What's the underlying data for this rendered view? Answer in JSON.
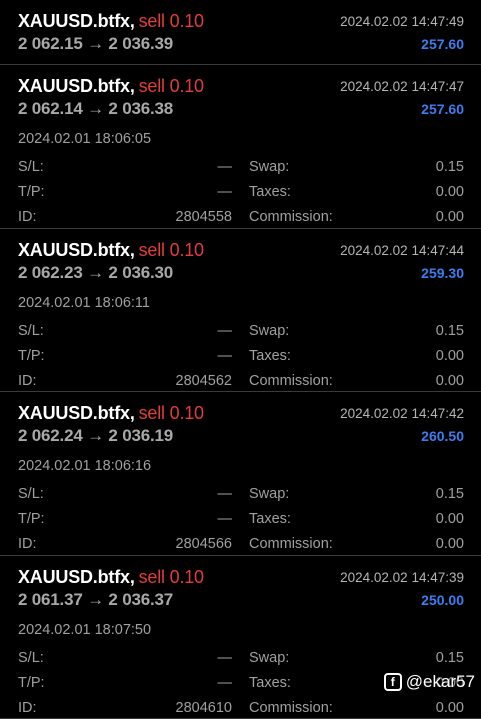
{
  "trades": [
    {
      "symbol": "XAUUSD.btfx",
      "side": "sell 0.10",
      "time": "2024.02.02 14:47:49",
      "prices": "2 062.15 → 2 036.39",
      "profit": "257.60",
      "expanded": false
    },
    {
      "symbol": "XAUUSD.btfx",
      "side": "sell 0.10",
      "time": "2024.02.02 14:47:47",
      "prices": "2 062.14 → 2 036.38",
      "profit": "257.60",
      "expanded": true,
      "open_time": "2024.02.01 18:06:05",
      "sl_label": "S/L:",
      "sl_value": "—",
      "tp_label": "T/P:",
      "tp_value": "—",
      "id_label": "ID:",
      "id_value": "2804558",
      "swap_label": "Swap:",
      "swap_value": "0.15",
      "taxes_label": "Taxes:",
      "taxes_value": "0.00",
      "commission_label": "Commission:",
      "commission_value": "0.00"
    },
    {
      "symbol": "XAUUSD.btfx",
      "side": "sell 0.10",
      "time": "2024.02.02 14:47:44",
      "prices": "2 062.23 → 2 036.30",
      "profit": "259.30",
      "expanded": true,
      "open_time": "2024.02.01 18:06:11",
      "sl_label": "S/L:",
      "sl_value": "—",
      "tp_label": "T/P:",
      "tp_value": "—",
      "id_label": "ID:",
      "id_value": "2804562",
      "swap_label": "Swap:",
      "swap_value": "0.15",
      "taxes_label": "Taxes:",
      "taxes_value": "0.00",
      "commission_label": "Commission:",
      "commission_value": "0.00"
    },
    {
      "symbol": "XAUUSD.btfx",
      "side": "sell 0.10",
      "time": "2024.02.02 14:47:42",
      "prices": "2 062.24 → 2 036.19",
      "profit": "260.50",
      "expanded": true,
      "open_time": "2024.02.01 18:06:16",
      "sl_label": "S/L:",
      "sl_value": "—",
      "tp_label": "T/P:",
      "tp_value": "—",
      "id_label": "ID:",
      "id_value": "2804566",
      "swap_label": "Swap:",
      "swap_value": "0.15",
      "taxes_label": "Taxes:",
      "taxes_value": "0.00",
      "commission_label": "Commission:",
      "commission_value": "0.00"
    },
    {
      "symbol": "XAUUSD.btfx",
      "side": "sell 0.10",
      "time": "2024.02.02 14:47:39",
      "prices": "2 061.37 → 2 036.37",
      "profit": "250.00",
      "expanded": true,
      "open_time": "2024.02.01 18:07:50",
      "sl_label": "S/L:",
      "sl_value": "—",
      "tp_label": "T/P:",
      "tp_value": "—",
      "id_label": "ID:",
      "id_value": "2804610",
      "swap_label": "Swap:",
      "swap_value": "0.15",
      "taxes_label": "Taxes:",
      "taxes_value": "0.00",
      "commission_label": "Commission:",
      "commission_value": "0.00"
    }
  ],
  "watermark": {
    "icon": "facebook-icon",
    "text": "@ekar57"
  },
  "colors": {
    "sell": "#e23c3c",
    "profit": "#3c7ef0",
    "background": "#000000"
  }
}
